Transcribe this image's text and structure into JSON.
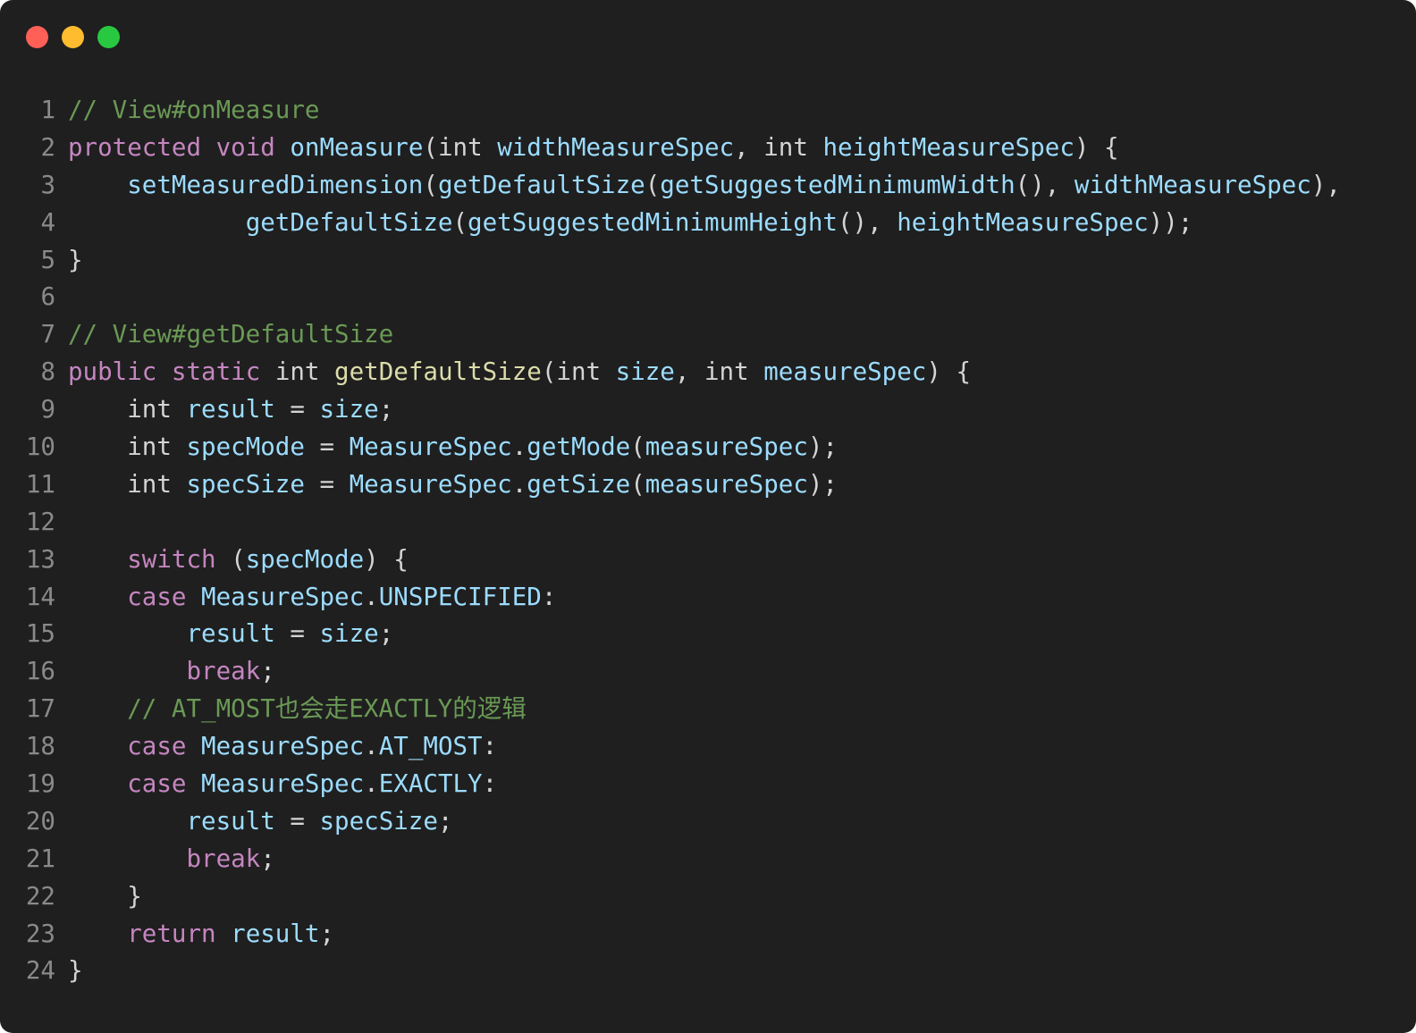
{
  "window": {
    "controls": {
      "close_color": "#fe5f57",
      "minimize_color": "#febc2e",
      "zoom_color": "#28c840"
    }
  },
  "code": {
    "language": "java",
    "lines": [
      {
        "n": "1",
        "tokens": [
          [
            "comment",
            "// View#onMeasure"
          ]
        ]
      },
      {
        "n": "2",
        "tokens": [
          [
            "keyword",
            "protected"
          ],
          [
            "plain",
            " "
          ],
          [
            "keyword",
            "void"
          ],
          [
            "plain",
            " "
          ],
          [
            "ident",
            "onMeasure"
          ],
          [
            "plain",
            "("
          ],
          [
            "type",
            "int"
          ],
          [
            "plain",
            " "
          ],
          [
            "ident",
            "widthMeasureSpec"
          ],
          [
            "plain",
            ", "
          ],
          [
            "type",
            "int"
          ],
          [
            "plain",
            " "
          ],
          [
            "ident",
            "heightMeasureSpec"
          ],
          [
            "plain",
            ") {"
          ]
        ]
      },
      {
        "n": "3",
        "tokens": [
          [
            "plain",
            "    "
          ],
          [
            "ident",
            "setMeasuredDimension"
          ],
          [
            "plain",
            "("
          ],
          [
            "ident",
            "getDefaultSize"
          ],
          [
            "plain",
            "("
          ],
          [
            "ident",
            "getSuggestedMinimumWidth"
          ],
          [
            "plain",
            "(), "
          ],
          [
            "ident",
            "widthMeasureSpec"
          ],
          [
            "plain",
            "),"
          ]
        ]
      },
      {
        "n": "4",
        "tokens": [
          [
            "plain",
            "            "
          ],
          [
            "ident",
            "getDefaultSize"
          ],
          [
            "plain",
            "("
          ],
          [
            "ident",
            "getSuggestedMinimumHeight"
          ],
          [
            "plain",
            "(), "
          ],
          [
            "ident",
            "heightMeasureSpec"
          ],
          [
            "plain",
            "));"
          ]
        ]
      },
      {
        "n": "5",
        "tokens": [
          [
            "plain",
            "}"
          ]
        ]
      },
      {
        "n": "6",
        "tokens": []
      },
      {
        "n": "7",
        "tokens": [
          [
            "comment",
            "// View#getDefaultSize"
          ]
        ]
      },
      {
        "n": "8",
        "tokens": [
          [
            "keyword",
            "public"
          ],
          [
            "plain",
            " "
          ],
          [
            "keyword",
            "static"
          ],
          [
            "plain",
            " "
          ],
          [
            "type",
            "int"
          ],
          [
            "plain",
            " "
          ],
          [
            "func",
            "getDefaultSize"
          ],
          [
            "plain",
            "("
          ],
          [
            "type",
            "int"
          ],
          [
            "plain",
            " "
          ],
          [
            "ident",
            "size"
          ],
          [
            "plain",
            ", "
          ],
          [
            "type",
            "int"
          ],
          [
            "plain",
            " "
          ],
          [
            "ident",
            "measureSpec"
          ],
          [
            "plain",
            ") {"
          ]
        ]
      },
      {
        "n": "9",
        "tokens": [
          [
            "plain",
            "    "
          ],
          [
            "type",
            "int"
          ],
          [
            "plain",
            " "
          ],
          [
            "ident",
            "result"
          ],
          [
            "plain",
            " = "
          ],
          [
            "ident",
            "size"
          ],
          [
            "plain",
            ";"
          ]
        ]
      },
      {
        "n": "10",
        "tokens": [
          [
            "plain",
            "    "
          ],
          [
            "type",
            "int"
          ],
          [
            "plain",
            " "
          ],
          [
            "ident",
            "specMode"
          ],
          [
            "plain",
            " = "
          ],
          [
            "ident",
            "MeasureSpec"
          ],
          [
            "plain",
            "."
          ],
          [
            "ident",
            "getMode"
          ],
          [
            "plain",
            "("
          ],
          [
            "ident",
            "measureSpec"
          ],
          [
            "plain",
            ");"
          ]
        ]
      },
      {
        "n": "11",
        "tokens": [
          [
            "plain",
            "    "
          ],
          [
            "type",
            "int"
          ],
          [
            "plain",
            " "
          ],
          [
            "ident",
            "specSize"
          ],
          [
            "plain",
            " = "
          ],
          [
            "ident",
            "MeasureSpec"
          ],
          [
            "plain",
            "."
          ],
          [
            "ident",
            "getSize"
          ],
          [
            "plain",
            "("
          ],
          [
            "ident",
            "measureSpec"
          ],
          [
            "plain",
            ");"
          ]
        ]
      },
      {
        "n": "12",
        "tokens": []
      },
      {
        "n": "13",
        "tokens": [
          [
            "plain",
            "    "
          ],
          [
            "keyword",
            "switch"
          ],
          [
            "plain",
            " ("
          ],
          [
            "ident",
            "specMode"
          ],
          [
            "plain",
            ") {"
          ]
        ]
      },
      {
        "n": "14",
        "tokens": [
          [
            "plain",
            "    "
          ],
          [
            "keyword",
            "case"
          ],
          [
            "plain",
            " "
          ],
          [
            "ident",
            "MeasureSpec"
          ],
          [
            "plain",
            "."
          ],
          [
            "ident",
            "UNSPECIFIED"
          ],
          [
            "plain",
            ":"
          ]
        ]
      },
      {
        "n": "15",
        "tokens": [
          [
            "plain",
            "        "
          ],
          [
            "ident",
            "result"
          ],
          [
            "plain",
            " = "
          ],
          [
            "ident",
            "size"
          ],
          [
            "plain",
            ";"
          ]
        ]
      },
      {
        "n": "16",
        "tokens": [
          [
            "plain",
            "        "
          ],
          [
            "keyword",
            "break"
          ],
          [
            "plain",
            ";"
          ]
        ]
      },
      {
        "n": "17",
        "tokens": [
          [
            "plain",
            "    "
          ],
          [
            "comment",
            "// AT_MOST也会走EXACTLY的逻辑"
          ]
        ]
      },
      {
        "n": "18",
        "tokens": [
          [
            "plain",
            "    "
          ],
          [
            "keyword",
            "case"
          ],
          [
            "plain",
            " "
          ],
          [
            "ident",
            "MeasureSpec"
          ],
          [
            "plain",
            "."
          ],
          [
            "ident",
            "AT_MOST"
          ],
          [
            "plain",
            ":"
          ]
        ]
      },
      {
        "n": "19",
        "tokens": [
          [
            "plain",
            "    "
          ],
          [
            "keyword",
            "case"
          ],
          [
            "plain",
            " "
          ],
          [
            "ident",
            "MeasureSpec"
          ],
          [
            "plain",
            "."
          ],
          [
            "ident",
            "EXACTLY"
          ],
          [
            "plain",
            ":"
          ]
        ]
      },
      {
        "n": "20",
        "tokens": [
          [
            "plain",
            "        "
          ],
          [
            "ident",
            "result"
          ],
          [
            "plain",
            " = "
          ],
          [
            "ident",
            "specSize"
          ],
          [
            "plain",
            ";"
          ]
        ]
      },
      {
        "n": "21",
        "tokens": [
          [
            "plain",
            "        "
          ],
          [
            "keyword",
            "break"
          ],
          [
            "plain",
            ";"
          ]
        ]
      },
      {
        "n": "22",
        "tokens": [
          [
            "plain",
            "    }"
          ]
        ]
      },
      {
        "n": "23",
        "tokens": [
          [
            "plain",
            "    "
          ],
          [
            "keyword",
            "return"
          ],
          [
            "plain",
            " "
          ],
          [
            "ident",
            "result"
          ],
          [
            "plain",
            ";"
          ]
        ]
      },
      {
        "n": "24",
        "tokens": [
          [
            "plain",
            "}"
          ]
        ]
      }
    ]
  }
}
